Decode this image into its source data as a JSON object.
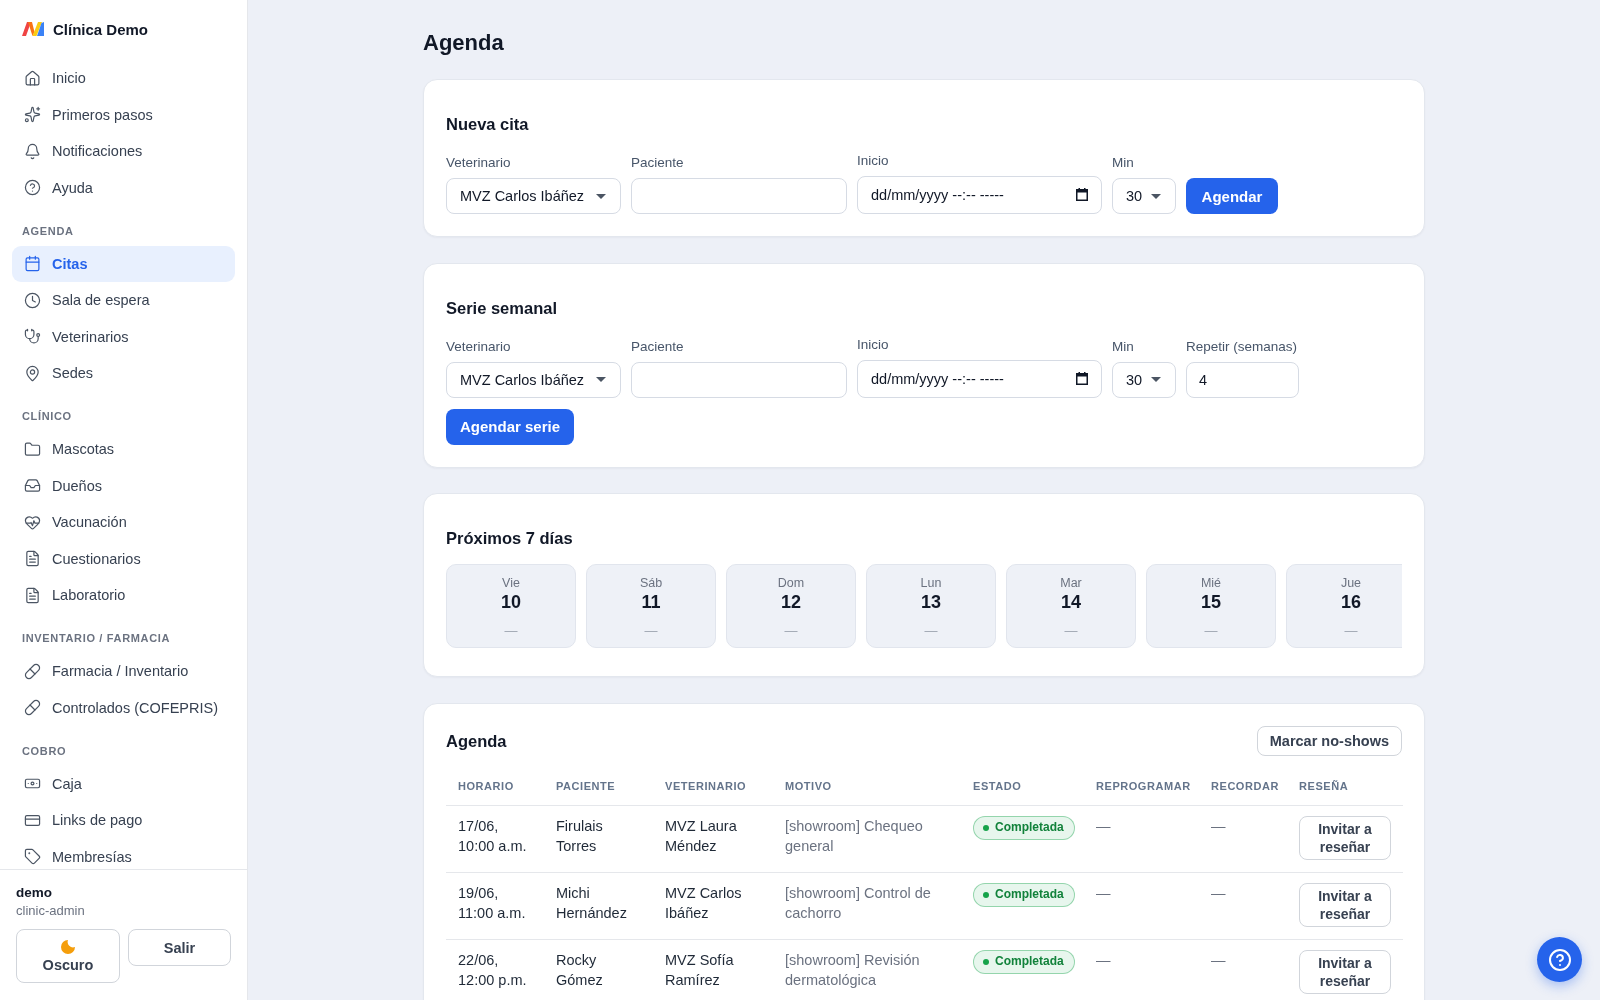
{
  "sidebar": {
    "brand": "Clínica Demo",
    "sections": [
      {
        "items": [
          {
            "label": "Inicio",
            "selected": false
          },
          {
            "label": "Primeros pasos",
            "selected": false
          },
          {
            "label": "Notificaciones",
            "selected": false
          },
          {
            "label": "Ayuda",
            "selected": false
          }
        ]
      },
      {
        "heading": "AGENDA",
        "items": [
          {
            "label": "Citas",
            "selected": true
          },
          {
            "label": "Sala de espera",
            "selected": false
          },
          {
            "label": "Veterinarios",
            "selected": false
          },
          {
            "label": "Sedes",
            "selected": false
          }
        ]
      },
      {
        "heading": "CLÍNICO",
        "items": [
          {
            "label": "Mascotas",
            "selected": false
          },
          {
            "label": "Dueños",
            "selected": false
          },
          {
            "label": "Vacunación",
            "selected": false
          },
          {
            "label": "Cuestionarios",
            "selected": false
          },
          {
            "label": "Laboratorio",
            "selected": false
          }
        ]
      },
      {
        "heading": "INVENTARIO / FARMACIA",
        "items": [
          {
            "label": "Farmacia / Inventario",
            "selected": false
          },
          {
            "label": "Controlados (COFEPRIS)",
            "selected": false
          }
        ]
      },
      {
        "heading": "COBRO",
        "items": [
          {
            "label": "Caja",
            "selected": false
          },
          {
            "label": "Links de pago",
            "selected": false
          },
          {
            "label": "Membresías",
            "selected": false
          }
        ]
      }
    ],
    "user": {
      "name": "demo",
      "role": "clinic-admin"
    },
    "buttons": [
      {
        "label": "Oscuro",
        "kind": "theme"
      },
      {
        "label": "Salir",
        "kind": "logout"
      }
    ]
  },
  "page": {
    "title": "Agenda"
  },
  "new_appointment": {
    "title": "Nueva cita",
    "fields": [
      {
        "kind": "select",
        "label": "Veterinario",
        "value": "MVZ Carlos Ibáñez"
      },
      {
        "kind": "text",
        "label": "Paciente"
      },
      {
        "kind": "datetime",
        "label": "Inicio",
        "placeholder": "dd/mm/yyyy --:-- -----"
      },
      {
        "kind": "select",
        "label": "Min",
        "value": "30"
      }
    ],
    "button": "Agendar"
  },
  "weekly_series": {
    "title": "Serie semanal",
    "fields": [
      {
        "kind": "select",
        "label": "Veterinario",
        "value": "MVZ Carlos Ibáñez"
      },
      {
        "kind": "text",
        "label": "Paciente"
      },
      {
        "kind": "datetime",
        "label": "Inicio",
        "placeholder": "dd/mm/yyyy --:-- -----"
      },
      {
        "kind": "select",
        "label": "Min",
        "value": "30"
      },
      {
        "kind": "number",
        "label": "Repetir (semanas)",
        "value": "4"
      }
    ],
    "button": "Agendar serie"
  },
  "next_days": {
    "title": "Próximos 7 días",
    "days": [
      {
        "weekday": "Vie",
        "date": "10",
        "summary": "—"
      },
      {
        "weekday": "Sáb",
        "date": "11",
        "summary": "—"
      },
      {
        "weekday": "Dom",
        "date": "12",
        "summary": "—"
      },
      {
        "weekday": "Lun",
        "date": "13",
        "summary": "—"
      },
      {
        "weekday": "Mar",
        "date": "14",
        "summary": "—"
      },
      {
        "weekday": "Mié",
        "date": "15",
        "summary": "—"
      },
      {
        "weekday": "Jue",
        "date": "16",
        "summary": "—"
      }
    ]
  },
  "agenda": {
    "title": "Agenda",
    "action": "Marcar no-shows",
    "columns": [
      "HORARIO",
      "PACIENTE",
      "VETERINARIO",
      "MOTIVO",
      "ESTADO",
      "REPROGRAMAR",
      "RECORDAR",
      "RESEÑA"
    ],
    "rows": [
      {
        "time": "17/06, 10:00 a.m.",
        "patient": "Firulais Torres",
        "vet": "MVZ Laura Méndez",
        "reason": "[showroom] Chequeo general",
        "status": {
          "label": "Completada",
          "color": "#16a34a"
        },
        "reschedule": "—",
        "reminder": "—",
        "review": "Invitar a reseñar"
      },
      {
        "time": "19/06, 11:00 a.m.",
        "patient": "Michi Hernández",
        "vet": "MVZ Carlos Ibáñez",
        "reason": "[showroom] Control de cachorro",
        "status": {
          "label": "Completada",
          "color": "#16a34a"
        },
        "reschedule": "—",
        "reminder": "—",
        "review": "Invitar a reseñar"
      },
      {
        "time": "22/06, 12:00 p.m.",
        "patient": "Rocky Gómez",
        "vet": "MVZ Sofía Ramírez",
        "reason": "[showroom] Revisión dermatológica",
        "status": {
          "label": "Completada",
          "color": "#16a34a"
        },
        "reschedule": "—",
        "reminder": "—",
        "review": "Invitar a reseñar"
      }
    ]
  }
}
